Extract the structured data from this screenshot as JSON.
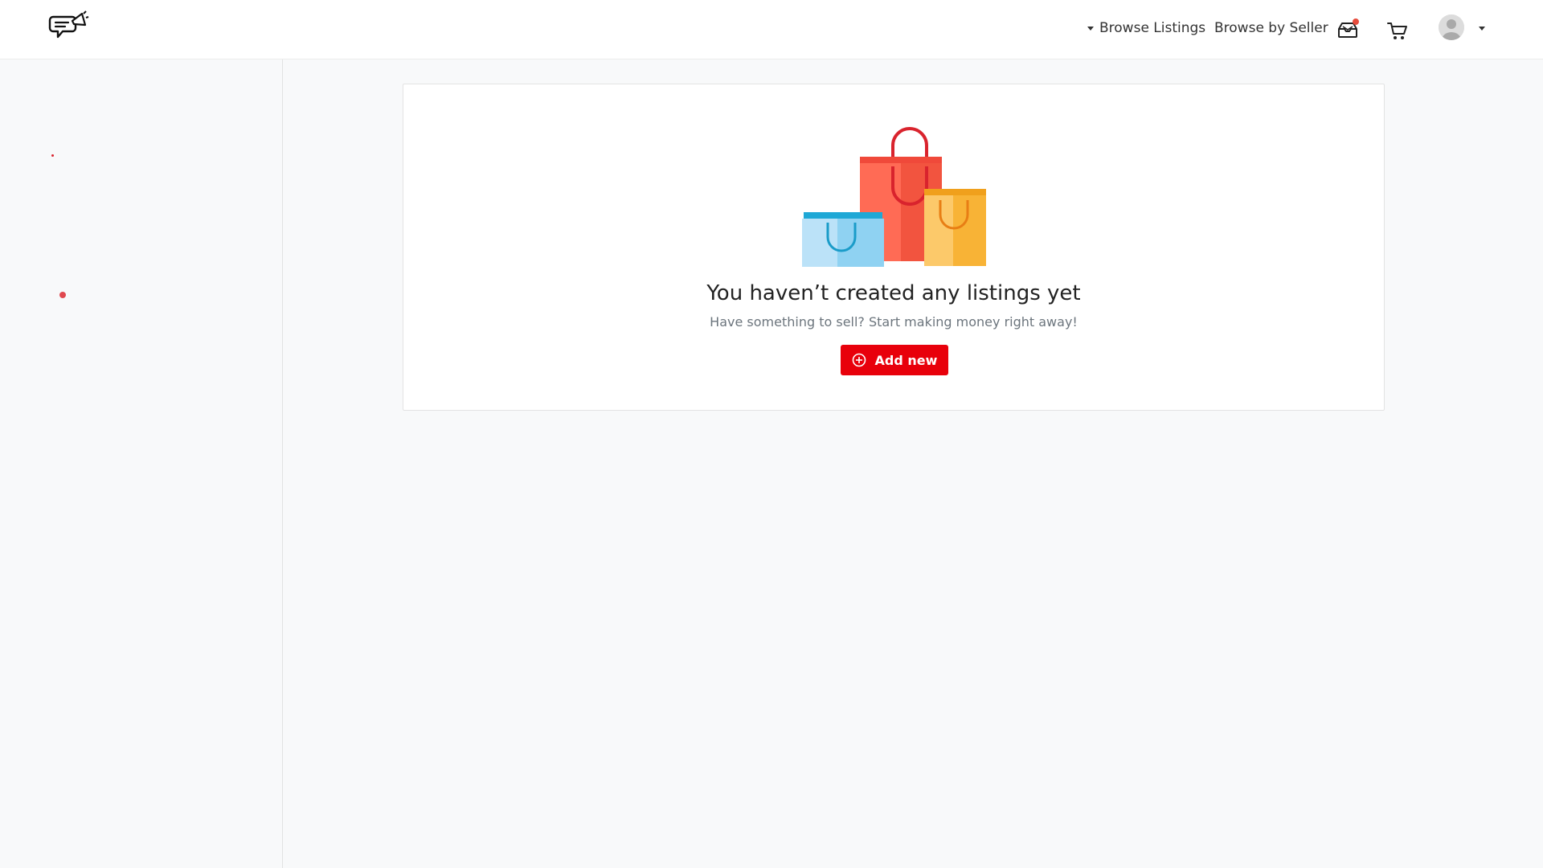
{
  "header": {
    "nav": {
      "browse_listings": "Browse Listings",
      "browse_by_seller": "Browse by Seller"
    },
    "icons": {
      "logo": "megaphone-chat-logo",
      "inbox": "inbox-icon",
      "cart": "cart-icon",
      "avatar": "user-avatar"
    },
    "inbox_has_notification": true
  },
  "empty_state": {
    "title": "You haven’t created any listings yet",
    "subtitle": "Have something to sell? Start making money right away!",
    "button_label": "Add new",
    "illustration": "shopping-bags"
  },
  "colors": {
    "accent": "#e8000b",
    "notification": "#e74c3c",
    "page_bg": "#f8f9fa",
    "card_bg": "#ffffff"
  }
}
